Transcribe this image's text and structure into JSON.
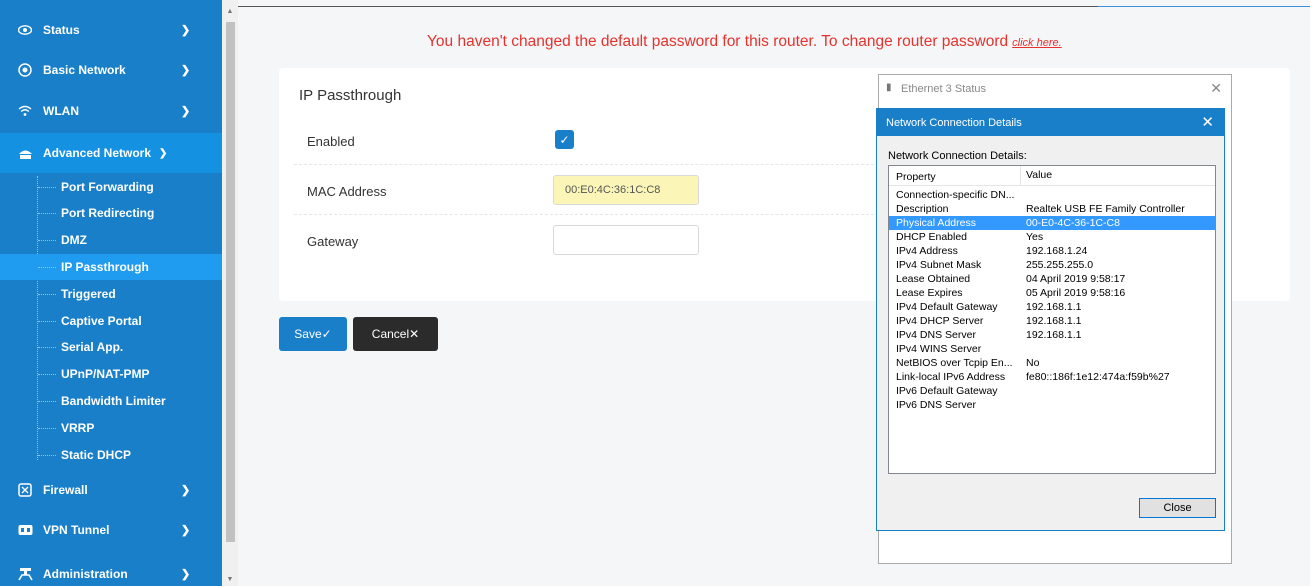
{
  "sidebar": {
    "menu": [
      {
        "label": "Status",
        "icon": "eye-icon"
      },
      {
        "label": "Basic Network",
        "icon": "globe-icon"
      },
      {
        "label": "WLAN",
        "icon": "wifi-icon"
      },
      {
        "label": "Advanced Network",
        "icon": "network-icon"
      },
      {
        "label": "Firewall",
        "icon": "firewall-icon"
      },
      {
        "label": "VPN Tunnel",
        "icon": "vpn-icon"
      },
      {
        "label": "Administration",
        "icon": "admin-icon"
      }
    ],
    "submenu": [
      "Port Forwarding",
      "Port Redirecting",
      "DMZ",
      "IP Passthrough",
      "Triggered",
      "Captive Portal",
      "Serial App.",
      "UPnP/NAT-PMP",
      "Bandwidth Limiter",
      "VRRP",
      "Static DHCP"
    ],
    "active_sub": "IP Passthrough"
  },
  "warning": {
    "text": "You haven't changed the default password for this router. To change router password",
    "link": "click here."
  },
  "panel": {
    "title": "IP Passthrough",
    "enabled_label": "Enabled",
    "enabled_checked": true,
    "mac_label": "MAC Address",
    "mac_value": "00:E0:4C:36:1C:C8",
    "gateway_label": "Gateway",
    "gateway_value": ""
  },
  "buttons": {
    "save": "Save✓",
    "cancel": "Cancel✕"
  },
  "back_window": {
    "title": "Ethernet 3 Status"
  },
  "dialog": {
    "title": "Network Connection Details",
    "subtitle": "Network Connection Details:",
    "col_property": "Property",
    "col_value": "Value",
    "rows": [
      {
        "p": "Connection-specific DN...",
        "v": ""
      },
      {
        "p": "Description",
        "v": "Realtek USB FE Family Controller"
      },
      {
        "p": "Physical Address",
        "v": "00-E0-4C-36-1C-C8"
      },
      {
        "p": "DHCP Enabled",
        "v": "Yes"
      },
      {
        "p": "IPv4 Address",
        "v": "192.168.1.24"
      },
      {
        "p": "IPv4 Subnet Mask",
        "v": "255.255.255.0"
      },
      {
        "p": "Lease Obtained",
        "v": "04 April 2019 9:58:17"
      },
      {
        "p": "Lease Expires",
        "v": "05 April 2019 9:58:16"
      },
      {
        "p": "IPv4 Default Gateway",
        "v": "192.168.1.1"
      },
      {
        "p": "IPv4 DHCP Server",
        "v": "192.168.1.1"
      },
      {
        "p": "IPv4 DNS Server",
        "v": "192.168.1.1"
      },
      {
        "p": "IPv4 WINS Server",
        "v": ""
      },
      {
        "p": "NetBIOS over Tcpip En...",
        "v": "No"
      },
      {
        "p": "Link-local IPv6 Address",
        "v": "fe80::186f:1e12:474a:f59b%27"
      },
      {
        "p": "IPv6 Default Gateway",
        "v": ""
      },
      {
        "p": "IPv6 DNS Server",
        "v": ""
      }
    ],
    "selected_row": "Physical Address",
    "close": "Close"
  },
  "colors": {
    "sidebar": "#1a7fc9",
    "active_item": "#1f9bf0",
    "warning": "#e5322d",
    "selection": "#3399ff"
  }
}
